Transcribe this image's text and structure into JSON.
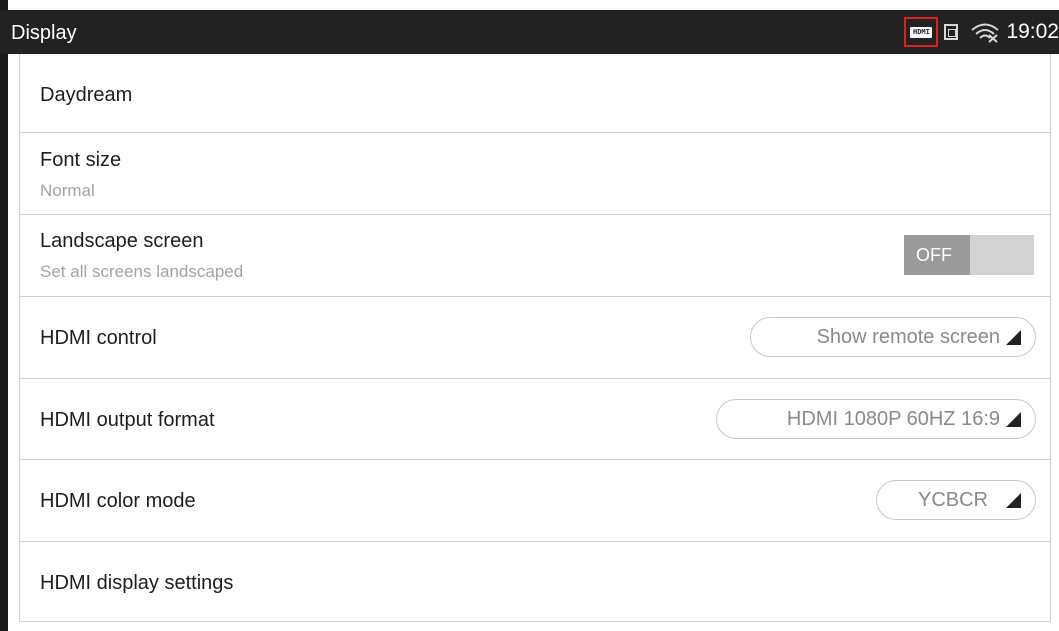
{
  "status_bar": {
    "title": "Display",
    "hdmi_icon_text": "HDMI",
    "time": "19:02"
  },
  "settings": {
    "daydream": {
      "title": "Daydream"
    },
    "font_size": {
      "title": "Font size",
      "summary": "Normal"
    },
    "landscape": {
      "title": "Landscape screen",
      "summary": "Set all screens landscaped",
      "toggle_state": "OFF"
    },
    "hdmi_control": {
      "title": "HDMI control",
      "value": "Show remote screen"
    },
    "hdmi_output_format": {
      "title": "HDMI output format",
      "value": "HDMI 1080P 60HZ 16:9"
    },
    "hdmi_color_mode": {
      "title": "HDMI color mode",
      "value": "YCBCR"
    },
    "hdmi_display_settings": {
      "title": "HDMI display settings"
    }
  },
  "icons": [
    "hdmi-icon",
    "sim-icon",
    "wifi-icon",
    "dropdown-triangle-icon"
  ],
  "colors": {
    "status_bar_bg": "#222222",
    "hdmi_highlight": "#e0201c",
    "toggle_off": "#9a9a9a",
    "summary_text": "#a3a3a3"
  }
}
